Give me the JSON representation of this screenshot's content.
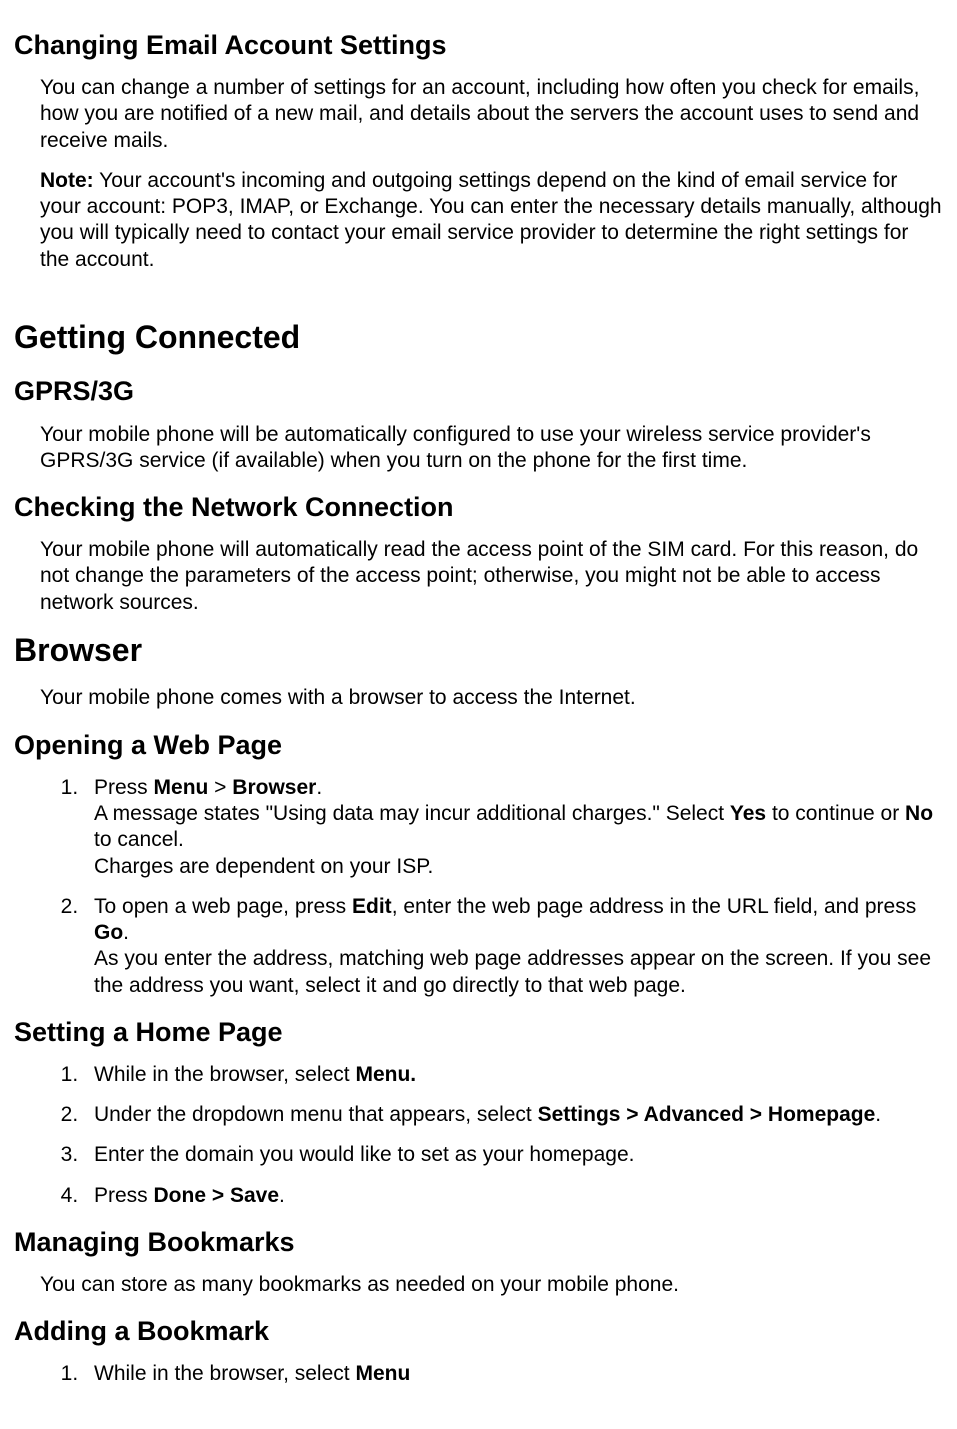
{
  "s1": {
    "title": "Changing Email Account Settings",
    "p1": "You can change a number of settings for an account, including how often you check for emails, how you are notified of a new mail, and details about the servers the account uses to send and receive mails.",
    "noteLabel": "Note:",
    "noteBody": " Your account's incoming and outgoing settings depend on the kind of email service for your account: POP3, IMAP, or Exchange. You can enter the necessary details manually, although you will typically need to contact your email service provider to determine the right settings for the account."
  },
  "s2": {
    "title": "Getting Connected",
    "sub1": {
      "title": "GPRS/3G",
      "p1": "Your mobile phone will be automatically configured to use your wireless service provider's GPRS/3G service (if available) when you turn on the phone for the first time."
    },
    "sub2": {
      "title": "Checking the Network Connection",
      "p1": "Your mobile phone will automatically read the access point of the SIM card. For this reason, do not change the parameters of the access point; otherwise, you might not be able to access network sources."
    }
  },
  "s3": {
    "title": "Browser",
    "p1": "Your mobile phone comes with a browser to access the Internet.",
    "sub1": {
      "title": "Opening a Web Page",
      "li1a": "Press ",
      "li1b": "Menu",
      "li1c": " > ",
      "li1d": "Browser",
      "li1e": ".",
      "li1f": "A message states \"Using data may incur additional charges.\" Select ",
      "li1g": "Yes",
      "li1h": " to continue or ",
      "li1i": "No",
      "li1j": " to cancel.",
      "li1k": "Charges are dependent on your ISP.",
      "li2a": "To open a web page, press ",
      "li2b": "Edit",
      "li2c": ", enter the web page address in the URL field, and press ",
      "li2d": "Go",
      "li2e": ".",
      "li2f": "As you enter the address, matching web page addresses appear on the screen. If you see the address you want, select it and go directly to that web page."
    },
    "sub2": {
      "title": "Setting a Home Page",
      "li1a": "While in the browser, select ",
      "li1b": "Menu.",
      "li2a": "Under the dropdown menu that appears, select ",
      "li2b": "Settings > Advanced > Homepage",
      "li2c": ".",
      "li3": "Enter the domain you would like to set as your homepage.",
      "li4a": "Press ",
      "li4b": "Done > Save",
      "li4c": "."
    },
    "sub3": {
      "title": "Managing Bookmarks",
      "p1": "You can store as many bookmarks as needed on your mobile phone."
    },
    "sub4": {
      "title": "Adding a Bookmark",
      "li1a": "While in the browser, select ",
      "li1b": "Menu"
    }
  }
}
